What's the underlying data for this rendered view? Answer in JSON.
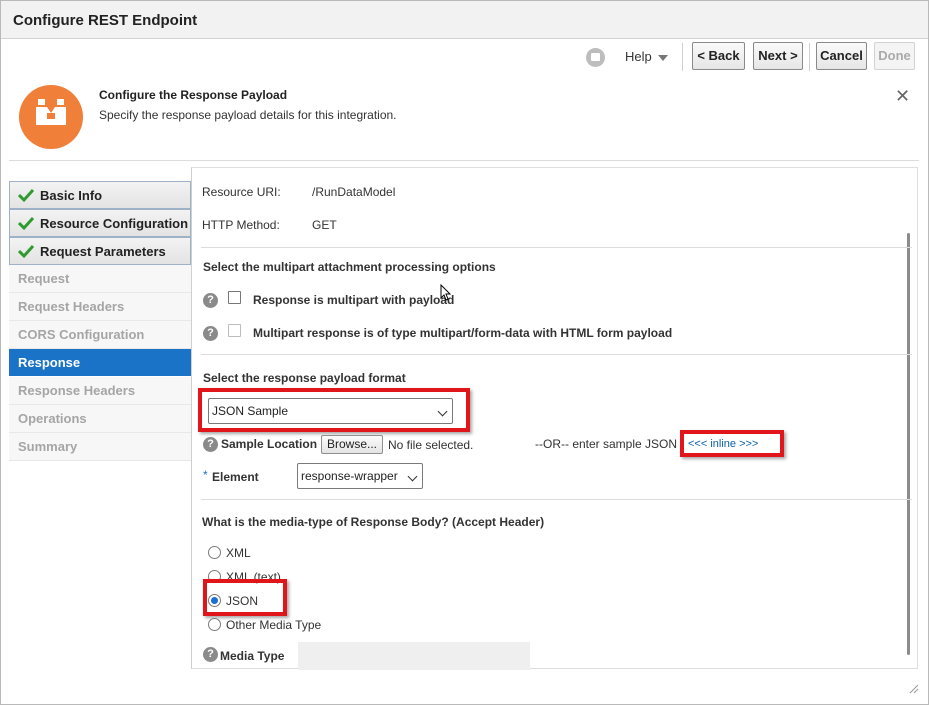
{
  "dialog": {
    "title": "Configure REST Endpoint"
  },
  "toolbar": {
    "help_label": "Help",
    "back_label": "< Back",
    "next_label": "Next >",
    "cancel_label": "Cancel",
    "done_label": "Done"
  },
  "header": {
    "title": "Configure the Response Payload",
    "subtitle": "Specify the response payload details for this integration.",
    "close_glyph": "✕"
  },
  "nav": {
    "items": [
      {
        "label": "Basic Info",
        "state": "done"
      },
      {
        "label": "Resource Configuration",
        "state": "done"
      },
      {
        "label": "Request Parameters",
        "state": "done"
      },
      {
        "label": "Request",
        "state": "disabled"
      },
      {
        "label": "Request Headers",
        "state": "disabled"
      },
      {
        "label": "CORS Configuration",
        "state": "disabled"
      },
      {
        "label": "Response",
        "state": "active"
      },
      {
        "label": "Response Headers",
        "state": "disabled"
      },
      {
        "label": "Operations",
        "state": "disabled"
      },
      {
        "label": "Summary",
        "state": "disabled"
      }
    ]
  },
  "resource": {
    "uri_label": "Resource URI:",
    "uri_value": "/RunDataModel",
    "method_label": "HTTP Method:",
    "method_value": "GET"
  },
  "multipart": {
    "heading": "Select the multipart attachment processing options",
    "option1": "Response is multipart with payload",
    "option2": "Multipart response is of type multipart/form-data with HTML form payload"
  },
  "payload": {
    "heading": "Select the response payload format",
    "format_value": "JSON Sample",
    "sample_location_label": "Sample Location",
    "browse_label": "Browse...",
    "no_file_text": "No file selected.",
    "or_text": "--OR-- enter sample JSON",
    "inline_link": "<<< inline >>>",
    "element_required": "*",
    "element_label": "Element",
    "element_value": "response-wrapper"
  },
  "media": {
    "heading": "What is the media-type of Response Body? (Accept Header)",
    "options": [
      "XML",
      "XML (text)",
      "JSON",
      "Other Media Type"
    ],
    "selected": "JSON",
    "media_type_label": "Media Type"
  },
  "colors": {
    "accent": "#1a73c6",
    "logo": "#f07f3a",
    "highlight": "#e0161a",
    "check": "#2e9b2e"
  }
}
